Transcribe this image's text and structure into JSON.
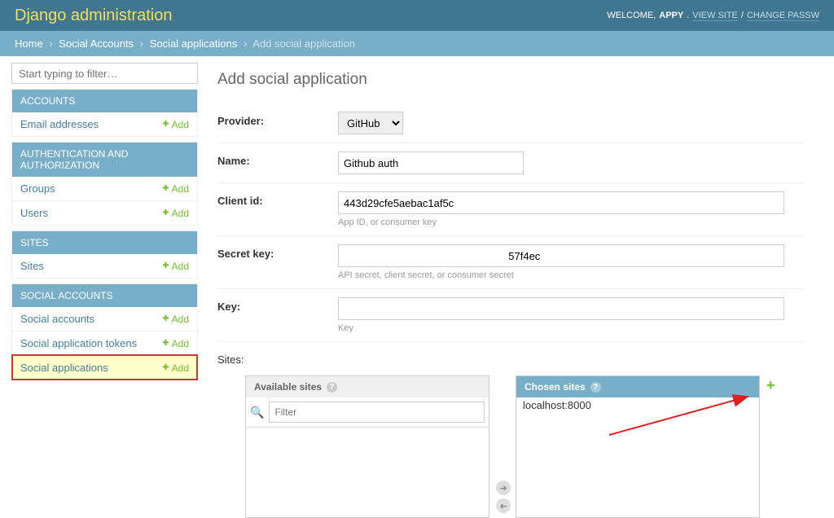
{
  "topbar": {
    "brand": "Django administration",
    "welcome": "WELCOME,",
    "user": "APPY",
    "view_site": "VIEW SITE",
    "change_pw": "CHANGE PASSW"
  },
  "breadcrumbs": {
    "home": "Home",
    "app": "Social Accounts",
    "model": "Social applications",
    "current": "Add social application"
  },
  "sidebar": {
    "filter_placeholder": "Start typing to filter…",
    "add_label": "Add",
    "sections": [
      {
        "title": "ACCOUNTS",
        "rows": [
          {
            "name": "Email addresses"
          }
        ]
      },
      {
        "title": "AUTHENTICATION AND AUTHORIZATION",
        "rows": [
          {
            "name": "Groups"
          },
          {
            "name": "Users"
          }
        ]
      },
      {
        "title": "SITES",
        "rows": [
          {
            "name": "Sites"
          }
        ]
      },
      {
        "title": "SOCIAL ACCOUNTS",
        "rows": [
          {
            "name": "Social accounts"
          },
          {
            "name": "Social application tokens"
          },
          {
            "name": "Social applications",
            "highlight": true
          }
        ]
      }
    ]
  },
  "form": {
    "heading": "Add social application",
    "provider_label": "Provider:",
    "provider_value": "GitHub",
    "name_label": "Name:",
    "name_value": "Github auth",
    "clientid_label": "Client id:",
    "clientid_value": "443d29cfe5aebac1af5c",
    "clientid_help": "App ID, or consumer key",
    "secret_label": "Secret key:",
    "secret_value": "                                                        57f4ec",
    "secret_help": "API secret, client secret, or consumer secret",
    "key_label": "Key:",
    "key_value": "",
    "key_help": "Key",
    "sites_label": "Sites:",
    "available_title": "Available sites",
    "chosen_title": "Chosen sites",
    "filter_placeholder": "Filter",
    "chosen_items": [
      "localhost:8000"
    ]
  }
}
